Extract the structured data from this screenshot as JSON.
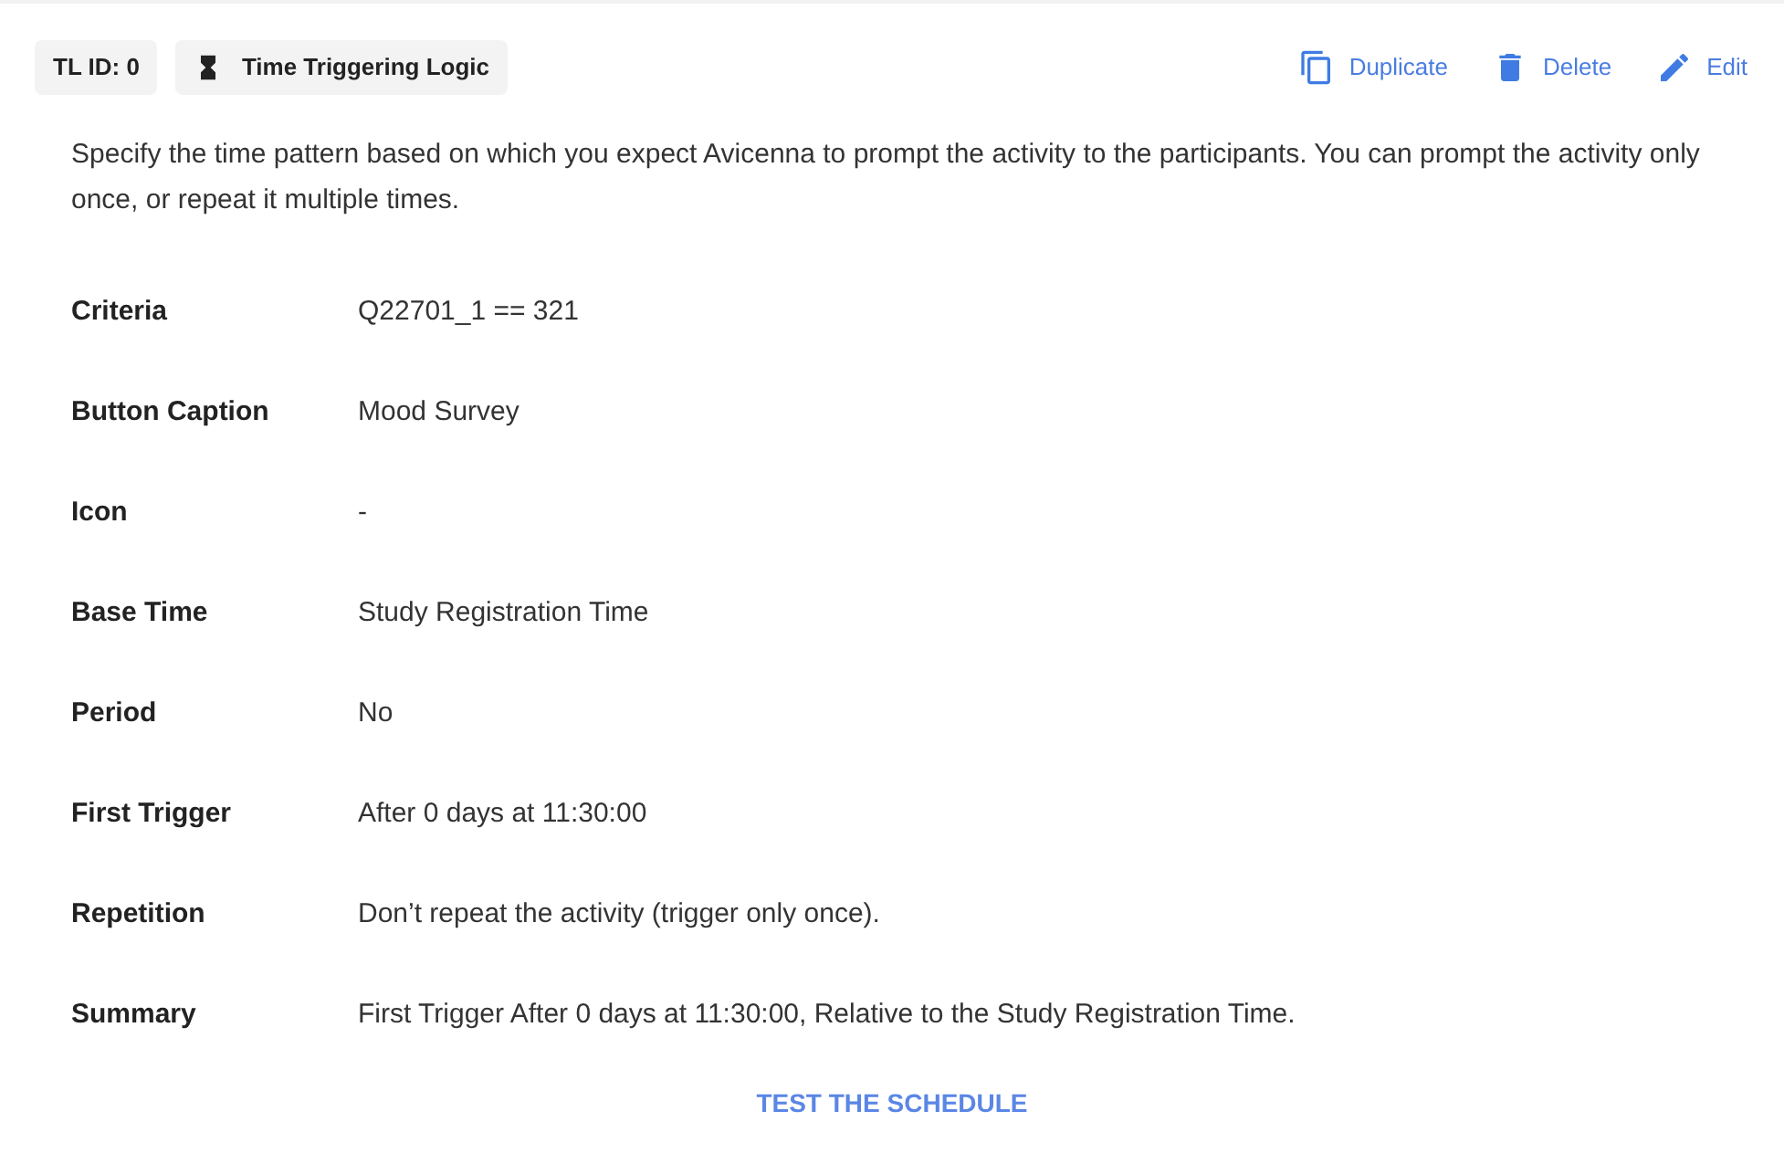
{
  "tags": [
    {
      "kind": "id",
      "label": "TL ID: 0"
    },
    {
      "kind": "hourglass",
      "label": "Time Triggering Logic"
    }
  ],
  "actions": [
    {
      "kind": "duplicate",
      "label": "Duplicate"
    },
    {
      "kind": "delete",
      "label": "Delete"
    },
    {
      "kind": "edit",
      "label": "Edit"
    }
  ],
  "description": "Specify the time pattern based on which you expect Avicenna to prompt the activity to the participants. You can prompt the activity only once, or repeat it multiple times.",
  "fields": [
    {
      "label": "Criteria",
      "value": "Q22701_1 == 321"
    },
    {
      "label": "Button Caption",
      "value": "Mood Survey"
    },
    {
      "label": "Icon",
      "value": "-"
    },
    {
      "label": "Base Time",
      "value": "Study Registration Time"
    },
    {
      "label": "Period",
      "value": "No"
    },
    {
      "label": "First Trigger",
      "value": "After 0 days at 11:30:00"
    },
    {
      "label": "Repetition",
      "value": "Don’t repeat the activity (trigger only once)."
    },
    {
      "label": "Summary",
      "value": "First Trigger After 0 days at 11:30:00, Relative to the Study Registration Time."
    }
  ],
  "test_button": "TEST THE SCHEDULE"
}
